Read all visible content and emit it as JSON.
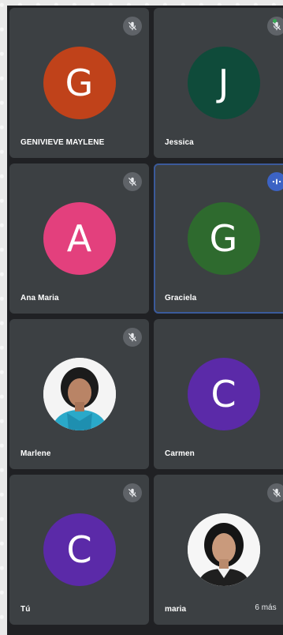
{
  "participants": [
    {
      "name": "GENIVIEVE MAYLENE",
      "initial": "G",
      "color": "#c0421a",
      "muted": true
    },
    {
      "name": "Jessica",
      "initial": "J",
      "color": "#0f4b3a",
      "muted": true
    },
    {
      "name": "Ana Maria",
      "initial": "A",
      "color": "#e3407d",
      "muted": true
    },
    {
      "name": "Graciela",
      "initial": "G",
      "color": "#2e6a2e",
      "muted": false,
      "speaking": true
    },
    {
      "name": "Marlene",
      "initial": "",
      "color": "#f2f2f2",
      "muted": true,
      "photo": true
    },
    {
      "name": "Carmen",
      "initial": "C",
      "color": "#5b2aa8",
      "muted": false
    },
    {
      "name": "Tú",
      "initial": "C",
      "color": "#5b2aa8",
      "muted": true
    },
    {
      "name": "maria",
      "initial": "",
      "color": "#f2f2f2",
      "muted": true,
      "photo": true
    }
  ],
  "more_label": "6 más",
  "status_dot_color": "#34a853"
}
